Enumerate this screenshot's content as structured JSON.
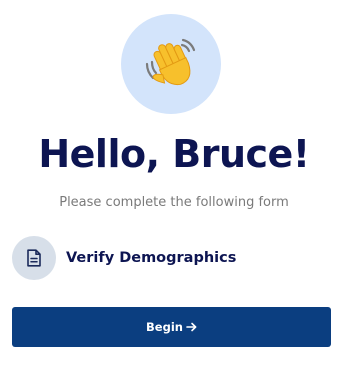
{
  "header": {
    "icon": "waving-hand-icon",
    "greeting": "Hello, Bruce!",
    "subtitle": "Please complete the following form"
  },
  "tasks": [
    {
      "icon": "document-icon",
      "label": "Verify Demographics"
    }
  ],
  "actions": {
    "begin_label": "Begin",
    "begin_icon": "arrow-right-icon"
  },
  "colors": {
    "heading": "#0d1552",
    "accent_circle": "#d3e4fb",
    "task_circle": "#d7dfe9",
    "button": "#0b3e80",
    "subtitle": "#7a7a7a"
  }
}
